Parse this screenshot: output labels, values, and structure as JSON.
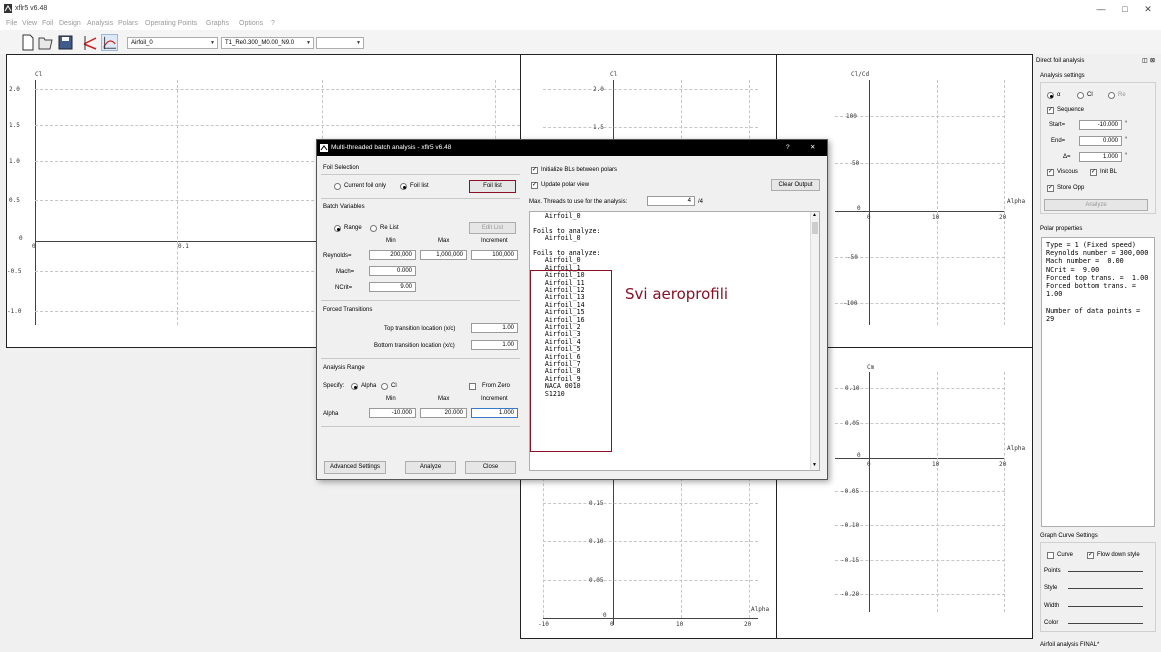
{
  "window": {
    "title": "xflr5 v6.48",
    "controls": [
      "—",
      "□",
      "✕"
    ]
  },
  "menu": [
    "File",
    "View",
    "Foil",
    "Design",
    "Analysis",
    "Polars",
    "Operating Points",
    "Graphs",
    "Options",
    "?"
  ],
  "toolbar": {
    "foil_combo": "Airfoil_0",
    "polar_combo": "T1_Re0.300_M0.00_N9.0",
    "opp_combo": ""
  },
  "graphs": {
    "cl_alpha": {
      "ylabel": "Cl",
      "yticks": [
        "2.0",
        "1.5",
        "1.0",
        "0.5",
        "0",
        "-0.5",
        "-1.0"
      ],
      "xticks": [
        "0",
        "0.1"
      ]
    },
    "cl_center": {
      "ylabel": "Cl",
      "yticks": [
        "2.0",
        "1.5"
      ]
    },
    "cl_cd": {
      "ylabel": "Cl/Cd",
      "yticks": [
        "100",
        "50",
        "0",
        "-50",
        "-100"
      ],
      "xticks": [
        "0",
        "10",
        "20"
      ],
      "xlabel": "Alpha"
    },
    "cm": {
      "ylabel": "Cm",
      "yticks": [
        "0.10",
        "0.05",
        "0",
        "-0.05",
        "-0.10",
        "-0.15",
        "-0.20"
      ],
      "xticks": [
        "0",
        "10",
        "20"
      ],
      "xlabel": "Alpha"
    },
    "bottom_center": {
      "yticks": [
        "0.15",
        "0.10",
        "0.05",
        "0"
      ],
      "xticks": [
        "-10",
        "0",
        "10",
        "20"
      ],
      "xlabel": "Alpha"
    }
  },
  "dock": {
    "title": "Direct foil analysis",
    "analysis_settings_label": "Analysis settings",
    "radio_alpha": "α",
    "radio_cl": "Cl",
    "radio_re": "Re",
    "sequence_label": "Sequence",
    "start_label": "Start=",
    "start_value": "-10.000",
    "end_label": "End=",
    "end_value": "0.000",
    "delta_label": "Δ=",
    "delta_value": "1.000",
    "deg_unit": "°",
    "viscous_label": "Viscous",
    "initbl_label": "Init BL",
    "storeopp_label": "Store Opp",
    "analyze_label": "Analyze",
    "polar_props_label": "Polar properties",
    "polar_props_text": "Type = 1 (Fixed speed)\nReynolds number = 300,000\nMach number =  0.00\nNCrit =  9.00\nForced top trans. =  1.00\nForced bottom trans. =  1.00\n\nNumber of data points = 29",
    "graph_curve_label": "Graph Curve Settings",
    "curve_label": "Curve",
    "flowdown_label": "Flow down style",
    "points_label": "Points",
    "style_label": "Style",
    "width_label": "Width",
    "color_label": "Color"
  },
  "dialog": {
    "title": "Multi-threaded batch analysis - xflr5 v6.48",
    "help": "?",
    "close": "✕",
    "foil_selection": "Foil Selection",
    "current_foil": "Current foil only",
    "foil_list_radio": "Foil list",
    "foil_list_button": "Foil list",
    "batch_variables": "Batch Variables",
    "range": "Range",
    "re_list": "Re List",
    "edit_list": "Edit List",
    "col_min": "Min",
    "col_max": "Max",
    "col_increment": "Increment",
    "reynolds_label": "Reynolds=",
    "re_min": "200,000",
    "re_max": "1,000,000",
    "re_inc": "100,000",
    "mach_label": "Mach=",
    "mach_value": "0.000",
    "ncrit_label": "NCrit=",
    "ncrit_value": "9.00",
    "forced_transitions": "Forced Transitions",
    "top_trans_label": "Top transition location (x/c)",
    "top_trans_value": "1.00",
    "bot_trans_label": "Bottom transition location (x/c)",
    "bot_trans_value": "1.00",
    "analysis_range": "Analysis Range",
    "specify_label": "Specify:",
    "alpha_radio": "Alpha",
    "cl_radio": "Cl",
    "from_zero": "From Zero",
    "alpha_label": "Alpha",
    "alpha_min": "-10.000",
    "alpha_max": "20.000",
    "alpha_inc": "1.000",
    "advanced_settings": "Advanced Settings",
    "analyze": "Analyze",
    "close_button": "Close",
    "init_bls": "Initialize BLs between polars",
    "update_polar": "Update polar view",
    "clear_output": "Clear Output",
    "max_threads_label": "Max. Threads to use for the analysis:",
    "max_threads_value": "4",
    "max_threads_total": "/4",
    "output_lines": [
      "   Airfoil_0",
      "",
      "Foils to analyze:",
      "   Airfoil_0",
      "",
      "Foils to analyze:",
      "   Airfoil_0",
      "   Airfoil_1",
      "   Airfoil_10",
      "   Airfoil_11",
      "   Airfoil_12",
      "   Airfoil_13",
      "   Airfoil_14",
      "   Airfoil_15",
      "   Airfoil_16",
      "   Airfoil_2",
      "   Airfoil_3",
      "   Airfoil_4",
      "   Airfoil_5",
      "   Airfoil_6",
      "   Airfoil_7",
      "   Airfoil_8",
      "   Airfoil_9",
      "   NACA 0010",
      "   S1210"
    ],
    "annotation": "Svi aeroprofili",
    "annotation_color": "#8a1025"
  },
  "status": "Airfoil analysis FINAL*"
}
